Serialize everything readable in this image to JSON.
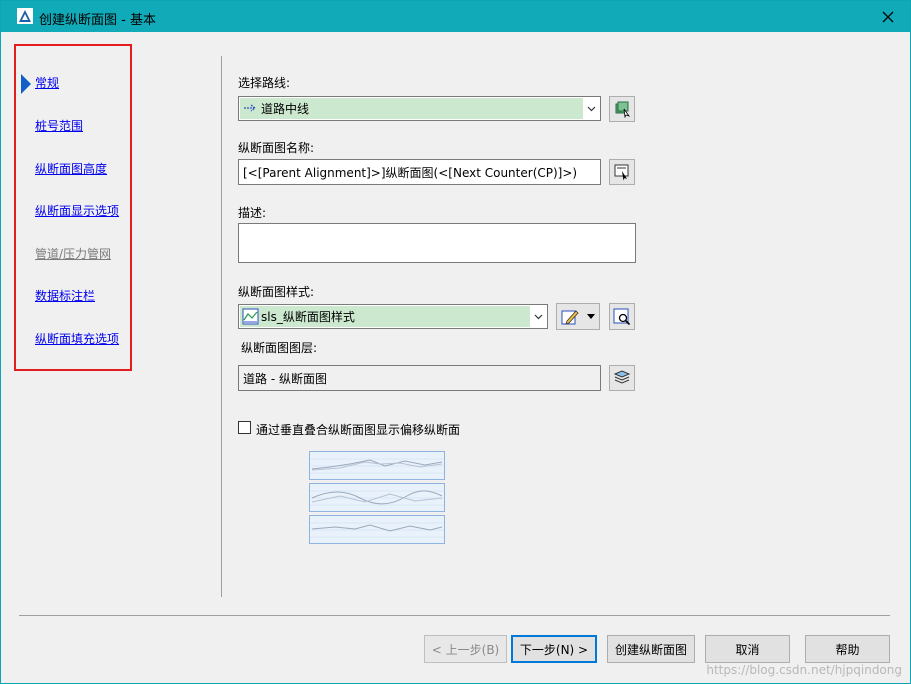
{
  "window": {
    "title": "创建纵断面图 - 基本"
  },
  "nav": {
    "items": [
      {
        "label": "常规",
        "active": true
      },
      {
        "label": "桩号范围"
      },
      {
        "label": "纵断面图高度"
      },
      {
        "label": "纵断面显示选项"
      },
      {
        "label": "管道/压力管网",
        "disabled": true
      },
      {
        "label": "数据标注栏"
      },
      {
        "label": "纵断面填充选项"
      }
    ]
  },
  "form": {
    "alignment_label": "选择路线:",
    "alignment_value": "道路中线",
    "name_label": "纵断面图名称:",
    "name_value": "[<[Parent Alignment]>]纵断面图(<[Next Counter(CP)]>)",
    "desc_label": "描述:",
    "desc_value": "",
    "style_label": "纵断面图样式:",
    "style_value": "sls_纵断面图样式",
    "layer_label": "纵断面图图层:",
    "layer_value": "道路 - 纵断面图",
    "stack_label": "通过垂直叠合纵断面图显示偏移纵断面",
    "stack_checked": false
  },
  "buttons": {
    "back": "< 上一步(B)",
    "next": "下一步(N) >",
    "create": "创建纵断面图",
    "cancel": "取消",
    "help": "帮助"
  },
  "watermark": "https://blog.csdn.net/hjpqindong",
  "colors": {
    "titlebar": "#10aab9",
    "selection_fill": "#cce8cf",
    "highlight_box": "#e31d1d",
    "link": "#0000ee"
  }
}
